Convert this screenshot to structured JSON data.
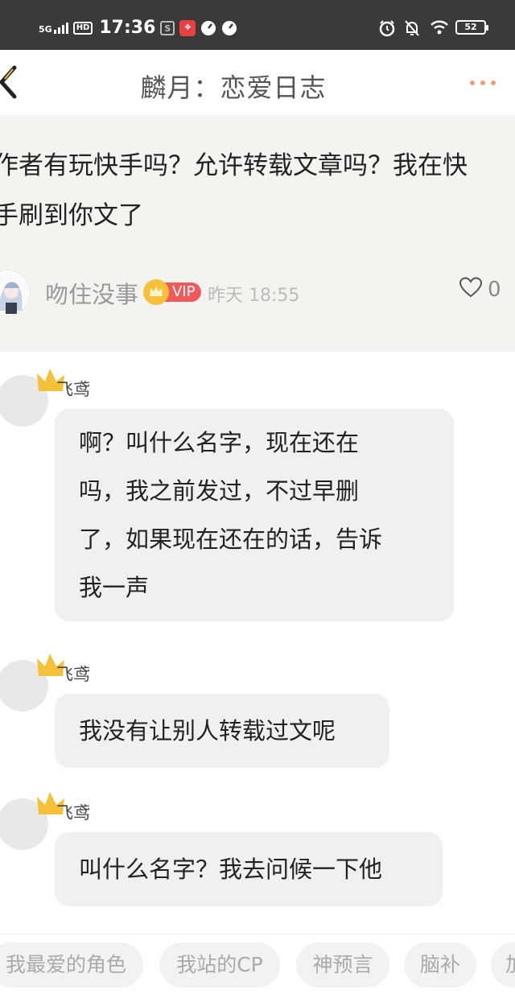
{
  "status_bar": {
    "network": "5G",
    "hd": "HD",
    "time": "17:36",
    "battery": "52",
    "icons": [
      "signal-icon",
      "hd-icon",
      "app-s-icon",
      "app-red-icon",
      "speed-icon",
      "speed-icon",
      "alarm-icon",
      "mute-icon",
      "wifi-icon",
      "battery-icon"
    ]
  },
  "header": {
    "title": "麟月：恋爱日志",
    "back_icon": "back-icon",
    "more_icon": "more-icon"
  },
  "main_comment": {
    "text_line1": "作者有玩快手吗？允许转载文章吗？我在快",
    "text_line2": "手刷到你文了",
    "author": "吻住没事",
    "vip": "VIP",
    "time": "昨天 18:55",
    "likes": "0"
  },
  "replies": [
    {
      "name": "飞鸢",
      "lines": [
        "啊？叫什么名字，现在还在",
        "吗，我之前发过，不过早删",
        "了，如果现在还在的话，告诉",
        "我一声"
      ]
    },
    {
      "name": "飞鸢",
      "lines": [
        "我没有让别人转载过文呢"
      ]
    },
    {
      "name": "飞鸢",
      "lines": [
        "叫什么名字？我去问候一下他"
      ]
    }
  ],
  "tags": [
    "我最爱的角色",
    "我站的CP",
    "神预言",
    "脑补",
    "加"
  ],
  "colors": {
    "status_bg": "#3a3a3a",
    "accent": "#f0a070",
    "vip": "#f05a5a",
    "crown": "#f5c13a",
    "panel": "#f3f3ef"
  }
}
